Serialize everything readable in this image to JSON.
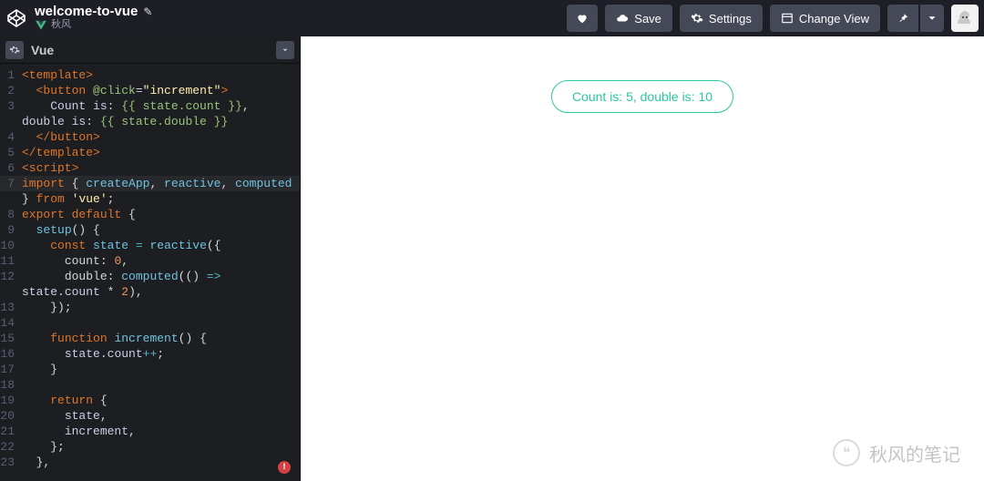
{
  "header": {
    "title": "welcome-to-vue",
    "subtitle": "秋风",
    "buttons": {
      "save": "Save",
      "settings": "Settings",
      "change_view": "Change View"
    }
  },
  "editor": {
    "panel_title": "Vue",
    "active_line": 7,
    "code_lines": [
      {
        "n": 1,
        "tokens": [
          [
            "tag",
            "<template>"
          ]
        ]
      },
      {
        "n": 2,
        "tokens": [
          [
            "punc",
            "  "
          ],
          [
            "tag",
            "<button"
          ],
          [
            "punc",
            " "
          ],
          [
            "attr",
            "@click"
          ],
          [
            "punc",
            "="
          ],
          [
            "str",
            "\"increment\""
          ],
          [
            "tag",
            ">"
          ]
        ]
      },
      {
        "n": 3,
        "tokens": [
          [
            "punc",
            "    "
          ],
          [
            "ident",
            "Count is: "
          ],
          [
            "mustache",
            "{{ state.count }}"
          ],
          [
            "punc",
            ","
          ]
        ]
      },
      {
        "n": null,
        "tokens": [
          [
            "ident",
            "double is: "
          ],
          [
            "mustache",
            "{{ state.double }}"
          ]
        ]
      },
      {
        "n": 4,
        "tokens": [
          [
            "punc",
            "  "
          ],
          [
            "tag",
            "</button>"
          ]
        ]
      },
      {
        "n": 5,
        "tokens": [
          [
            "tag",
            "</template>"
          ]
        ]
      },
      {
        "n": 6,
        "tokens": [
          [
            "tag",
            "<script>"
          ]
        ]
      },
      {
        "n": 7,
        "tokens": [
          [
            "kw",
            "import"
          ],
          [
            "punc",
            " { "
          ],
          [
            "call",
            "createApp"
          ],
          [
            "punc",
            ", "
          ],
          [
            "call",
            "reactive"
          ],
          [
            "punc",
            ", "
          ],
          [
            "call",
            "computed"
          ]
        ]
      },
      {
        "n": null,
        "tokens": [
          [
            "punc",
            "} "
          ],
          [
            "kw",
            "from"
          ],
          [
            "punc",
            " "
          ],
          [
            "str",
            "'vue'"
          ],
          [
            "punc",
            ";"
          ]
        ]
      },
      {
        "n": 8,
        "tokens": [
          [
            "kw",
            "export"
          ],
          [
            "punc",
            " "
          ],
          [
            "kw",
            "default"
          ],
          [
            "punc",
            " {"
          ]
        ]
      },
      {
        "n": 9,
        "tokens": [
          [
            "punc",
            "  "
          ],
          [
            "call",
            "setup"
          ],
          [
            "punc",
            "() {"
          ]
        ]
      },
      {
        "n": 10,
        "tokens": [
          [
            "punc",
            "    "
          ],
          [
            "kw",
            "const"
          ],
          [
            "punc",
            " "
          ],
          [
            "var",
            "state"
          ],
          [
            "punc",
            " "
          ],
          [
            "op",
            "="
          ],
          [
            "punc",
            " "
          ],
          [
            "call",
            "reactive"
          ],
          [
            "punc",
            "({"
          ]
        ]
      },
      {
        "n": 11,
        "tokens": [
          [
            "punc",
            "      "
          ],
          [
            "prop",
            "count"
          ],
          [
            "punc",
            ": "
          ],
          [
            "num",
            "0"
          ],
          [
            "punc",
            ","
          ]
        ]
      },
      {
        "n": 12,
        "tokens": [
          [
            "punc",
            "      "
          ],
          [
            "prop",
            "double"
          ],
          [
            "punc",
            ": "
          ],
          [
            "call",
            "computed"
          ],
          [
            "punc",
            "(() "
          ],
          [
            "op",
            "=>"
          ]
        ]
      },
      {
        "n": null,
        "tokens": [
          [
            "ident",
            "state"
          ],
          [
            "punc",
            "."
          ],
          [
            "ident",
            "count"
          ],
          [
            "punc",
            " * "
          ],
          [
            "num",
            "2"
          ],
          [
            "punc",
            "),"
          ]
        ]
      },
      {
        "n": 13,
        "tokens": [
          [
            "punc",
            "    });"
          ]
        ]
      },
      {
        "n": 14,
        "tokens": []
      },
      {
        "n": 15,
        "tokens": [
          [
            "punc",
            "    "
          ],
          [
            "kw2",
            "function"
          ],
          [
            "punc",
            " "
          ],
          [
            "call",
            "increment"
          ],
          [
            "punc",
            "() {"
          ]
        ]
      },
      {
        "n": 16,
        "tokens": [
          [
            "punc",
            "      "
          ],
          [
            "ident",
            "state"
          ],
          [
            "punc",
            "."
          ],
          [
            "ident",
            "count"
          ],
          [
            "op",
            "++"
          ],
          [
            "punc",
            ";"
          ]
        ]
      },
      {
        "n": 17,
        "tokens": [
          [
            "punc",
            "    }"
          ]
        ]
      },
      {
        "n": 18,
        "tokens": []
      },
      {
        "n": 19,
        "tokens": [
          [
            "punc",
            "    "
          ],
          [
            "kw2",
            "return"
          ],
          [
            "punc",
            " {"
          ]
        ]
      },
      {
        "n": 20,
        "tokens": [
          [
            "punc",
            "      "
          ],
          [
            "ident",
            "state"
          ],
          [
            "punc",
            ","
          ]
        ]
      },
      {
        "n": 21,
        "tokens": [
          [
            "punc",
            "      "
          ],
          [
            "ident",
            "increment"
          ],
          [
            "punc",
            ","
          ]
        ]
      },
      {
        "n": 22,
        "tokens": [
          [
            "punc",
            "    };"
          ]
        ]
      },
      {
        "n": 23,
        "tokens": [
          [
            "punc",
            "  },"
          ]
        ]
      }
    ],
    "error_badge": "!"
  },
  "preview": {
    "button_label": "Count is: 5, double is: 10"
  },
  "watermark": {
    "text": "秋风的笔记"
  }
}
